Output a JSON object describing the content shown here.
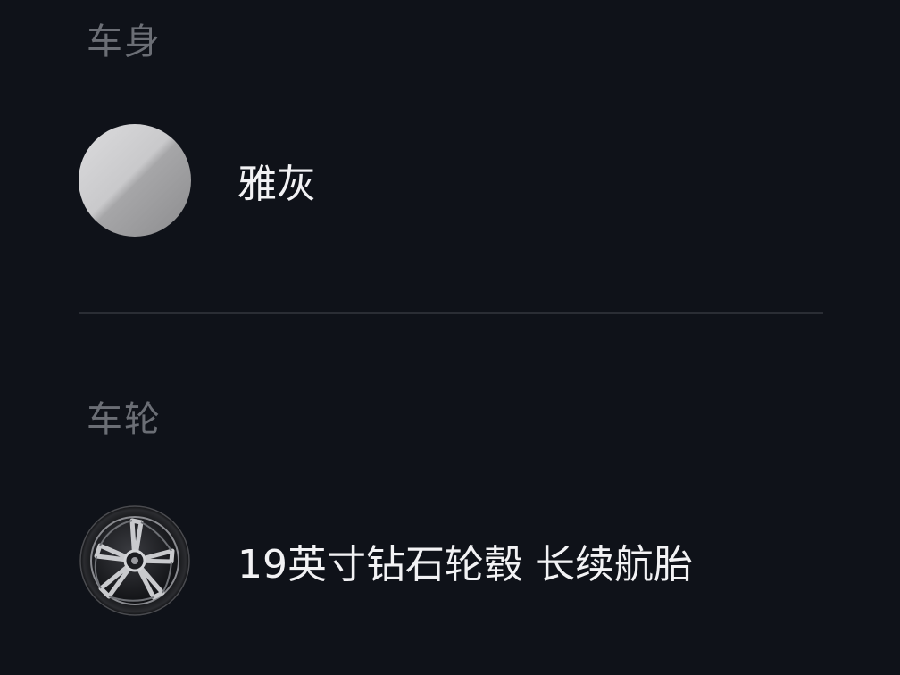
{
  "body_section": {
    "title": "车身",
    "option": {
      "label": "雅灰",
      "swatch_color": "#b5b5b7"
    }
  },
  "wheel_section": {
    "title": "车轮",
    "option": {
      "label": "19英寸钻石轮毂 长续航胎",
      "icon": "wheel-icon"
    }
  },
  "colors": {
    "background": "#0f1219",
    "section_title": "#6b6e75",
    "label": "#f2f2f4",
    "divider": "#2a2d34"
  }
}
